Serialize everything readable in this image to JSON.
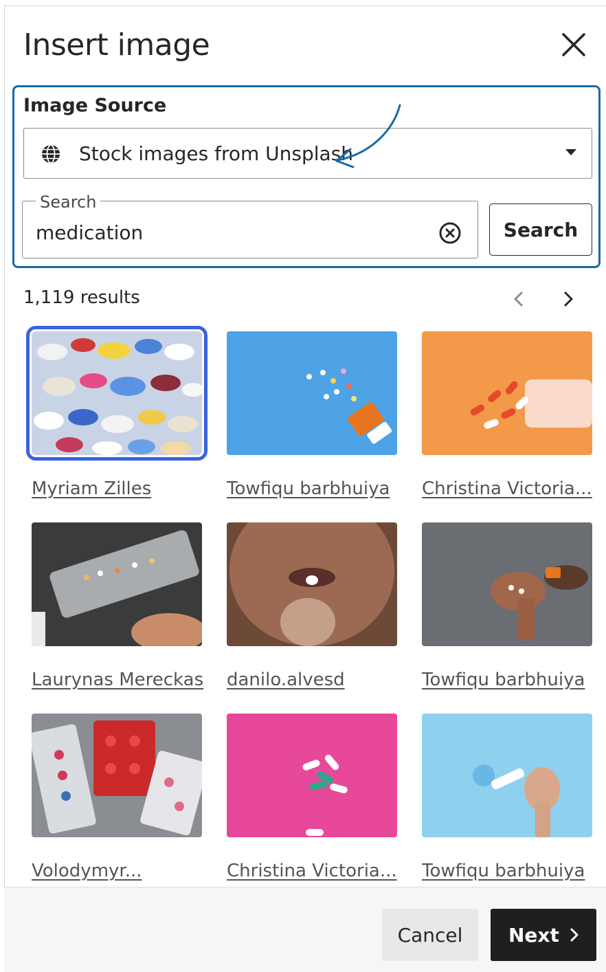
{
  "dialog": {
    "title": "Insert image",
    "close_icon": "close-icon"
  },
  "source": {
    "label": "Image Source",
    "selected": "Stock images from Unsplash",
    "icon": "globe-icon"
  },
  "search": {
    "legend": "Search",
    "value": "medication",
    "button_label": "Search"
  },
  "results": {
    "count_text": "1,119 results",
    "items": [
      {
        "credit": "Myriam Zilles",
        "selected": true
      },
      {
        "credit": "Towfiqu barbhuiya",
        "selected": false
      },
      {
        "credit": "Christina Victoria...",
        "selected": false
      },
      {
        "credit": "Laurynas Mereckas",
        "selected": false
      },
      {
        "credit": "danilo.alvesd",
        "selected": false
      },
      {
        "credit": "Towfiqu barbhuiya",
        "selected": false
      },
      {
        "credit": "Volodymyr...",
        "selected": false
      },
      {
        "credit": "Christina Victoria...",
        "selected": false
      },
      {
        "credit": "Towfiqu barbhuiya",
        "selected": false
      }
    ]
  },
  "footer": {
    "cancel_label": "Cancel",
    "next_label": "Next"
  },
  "colors": {
    "accent_border": "#1a6aa5",
    "selected_outline": "#3a62e0",
    "primary_button": "#1f1f1f"
  }
}
